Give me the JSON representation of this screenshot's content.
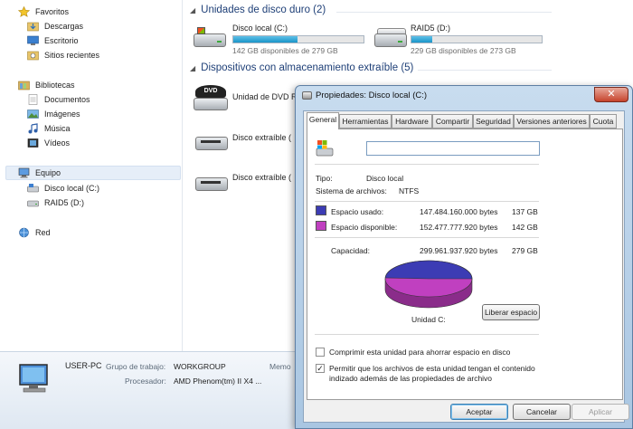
{
  "nav": {
    "favorites": "Favoritos",
    "downloads": "Descargas",
    "desktop": "Escritorio",
    "recent": "Sitios recientes",
    "libraries": "Bibliotecas",
    "documents": "Documentos",
    "pictures": "Imágenes",
    "music": "Música",
    "videos": "Vídeos",
    "computer": "Equipo",
    "local_disk": "Disco local (C:)",
    "raid": "RAID5 (D:)",
    "network": "Red"
  },
  "groups": {
    "hard_disks": "Unidades de disco duro (2)",
    "removable": "Dispositivos con almacenamiento extraíble (5)"
  },
  "drives": [
    {
      "name": "Disco local (C:)",
      "free": "142 GB disponibles de 279 GB",
      "used_fraction": 0.49
    },
    {
      "name": "RAID5 (D:)",
      "free": "229 GB disponibles de 273 GB",
      "used_fraction": 0.16
    }
  ],
  "removable": [
    {
      "name": "Unidad de DVD R",
      "dvd_label": "DVD"
    },
    {
      "name": "Disco extraíble ("
    },
    {
      "name": "Disco extraíble ("
    }
  ],
  "details": {
    "computer_name": "USER-PC",
    "workgroup_label": "Grupo de trabajo:",
    "workgroup_value": "WORKGROUP",
    "processor_label": "Procesador:",
    "processor_value": "AMD Phenom(tm) II X4 ...",
    "memory_label": "Memo"
  },
  "dialog": {
    "title": "Propiedades: Disco local (C:)",
    "close": "✕",
    "tabs": [
      "General",
      "Herramientas",
      "Hardware",
      "Compartir",
      "Seguridad",
      "Versiones anteriores",
      "Cuota"
    ],
    "name_value": "",
    "type_label": "Tipo:",
    "type_value": "Disco local",
    "fs_label": "Sistema de archivos:",
    "fs_value": "NTFS",
    "used_label": "Espacio usado:",
    "used_bytes": "147.484.160.000 bytes",
    "used_gb": "137 GB",
    "free_label": "Espacio disponible:",
    "free_bytes": "152.477.777.920 bytes",
    "free_gb": "142 GB",
    "capacity_label": "Capacidad:",
    "capacity_bytes": "299.961.937.920 bytes",
    "capacity_gb": "279 GB",
    "unit_label": "Unidad C:",
    "cleanup_button": "Liberar espacio",
    "compress_label": "Comprimir esta unidad para ahorrar espacio en disco",
    "index_label_1": "Permitir que los archivos de esta unidad tengan el contenido",
    "index_label_2": "indizado además de las propiedades de archivo",
    "ok": "Aceptar",
    "cancel": "Cancelar",
    "apply": "Aplicar",
    "used_fraction": 0.4917,
    "used_color": "#3c3cb4",
    "free_color": "#c040c0"
  }
}
